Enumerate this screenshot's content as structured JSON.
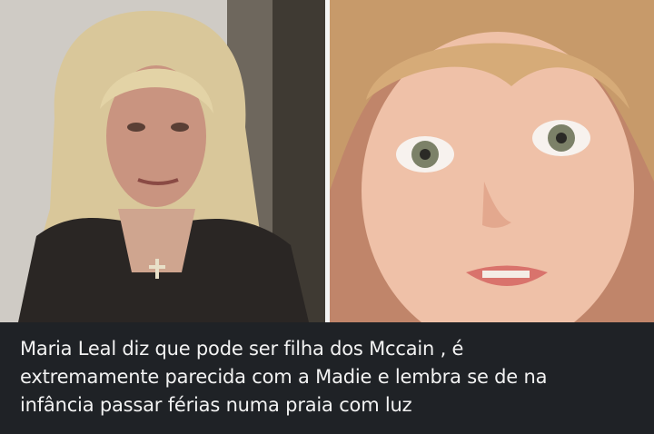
{
  "caption": {
    "lines": [
      "Maria Leal diz que pode ser filha dos Mccain , é",
      "extremamente parecida com a Madie e lembra se de na",
      "infância passar férias numa praia com luz"
    ]
  },
  "colors": {
    "caption_background": "#1f2226",
    "caption_text": "#f2f2f2",
    "divider": "#f4f4f4"
  }
}
